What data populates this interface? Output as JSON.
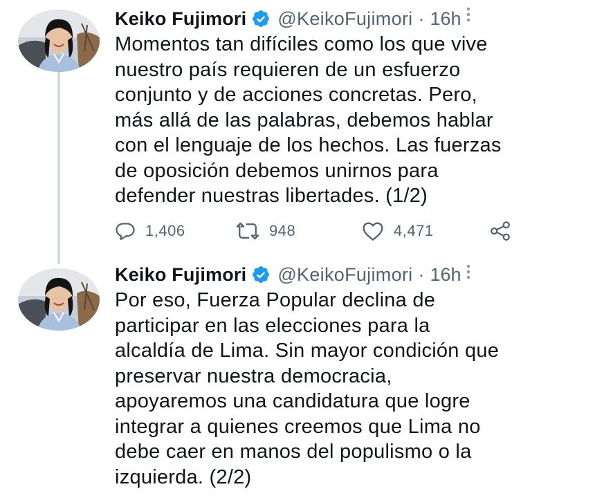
{
  "tweets": [
    {
      "author": {
        "name": "Keiko Fujimori",
        "handle": "@KeikoFujimori",
        "verified_icon": "verified-badge-icon"
      },
      "separator": "·",
      "time": "16h",
      "text": "Momentos tan difíciles como los que vive\nnuestro país requieren de un esfuerzo\nconjunto y de acciones concretas. Pero,\nmás allá de las palabras, debemos hablar\ncon el lenguaje de los hechos. Las fuerzas\nde oposición debemos unirnos para\ndefender nuestras libertades. (1/2)",
      "stats": {
        "replies": "1,406",
        "retweets": "948",
        "likes": "4,471"
      }
    },
    {
      "author": {
        "name": "Keiko Fujimori",
        "handle": "@KeikoFujimori",
        "verified_icon": "verified-badge-icon"
      },
      "separator": "·",
      "time": "16h",
      "text": "Por eso, Fuerza Popular declina de\nparticipar en las elecciones para la\nalcaldía de Lima. Sin mayor condición que\npreservar nuestra democracia,\napoyaremos una candidatura que logre\nintegrar a quienes creemos que Lima no\ndebe caer en manos del populismo o la\nizquierda. (2/2)"
    }
  ],
  "icons": {
    "reply": "speech-bubble-icon",
    "retweet": "retweet-arrows-icon",
    "like": "heart-icon",
    "share": "share-nodes-icon",
    "more": "vertical-ellipsis-icon"
  },
  "colors": {
    "text": "#0f1419",
    "secondary": "#536471",
    "verified": "#1d9bf0",
    "thread_line": "#cfd9de"
  }
}
